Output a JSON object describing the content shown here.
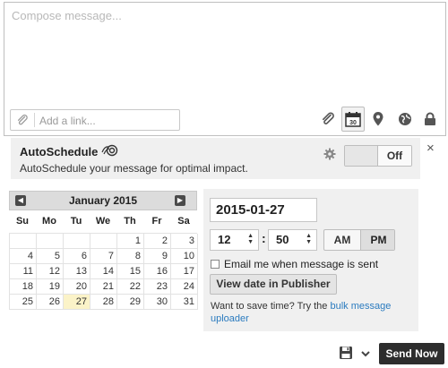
{
  "compose": {
    "placeholder": "Compose message...",
    "link_placeholder": "Add a link...",
    "toolbar_icons": [
      "paperclip-icon",
      "calendar-icon",
      "location-pin-icon",
      "globe-icon",
      "lock-icon"
    ],
    "calendar_icon_number": "30"
  },
  "autoschedule": {
    "title": "AutoSchedule",
    "description": "AutoSchedule your message for optimal impact.",
    "toggle_label": "Off",
    "close_label": "×"
  },
  "calendar": {
    "month_label": "January 2015",
    "prev_label": "◀",
    "next_label": "▶",
    "weekdays": [
      "Su",
      "Mo",
      "Tu",
      "We",
      "Th",
      "Fr",
      "Sa"
    ],
    "weeks": [
      [
        "",
        "",
        "",
        "",
        "1",
        "2",
        "3"
      ],
      [
        "4",
        "5",
        "6",
        "7",
        "8",
        "9",
        "10"
      ],
      [
        "11",
        "12",
        "13",
        "14",
        "15",
        "16",
        "17"
      ],
      [
        "18",
        "19",
        "20",
        "21",
        "22",
        "23",
        "24"
      ],
      [
        "25",
        "26",
        "27",
        "28",
        "29",
        "30",
        "31"
      ]
    ],
    "highlighted_day": "27"
  },
  "datetime": {
    "date_value": "2015-01-27",
    "hour": "12",
    "separator": ":",
    "minute": "50",
    "am_label": "AM",
    "pm_label": "PM",
    "selected_period": "PM",
    "email_label": "Email me when message is sent",
    "email_checked": false,
    "view_button": "View date in Publisher",
    "save_time_prefix": "Want to save time? Try the ",
    "save_time_link": "bulk message uploader"
  },
  "actions": {
    "send_label": "Send Now",
    "dropdown_glyph": "⌄"
  },
  "colors": {
    "send_button": "#2d2d2d",
    "link": "#2b7bbf",
    "today_highlight": "#fbf3c8",
    "panel_bg": "#f0f0f0"
  }
}
